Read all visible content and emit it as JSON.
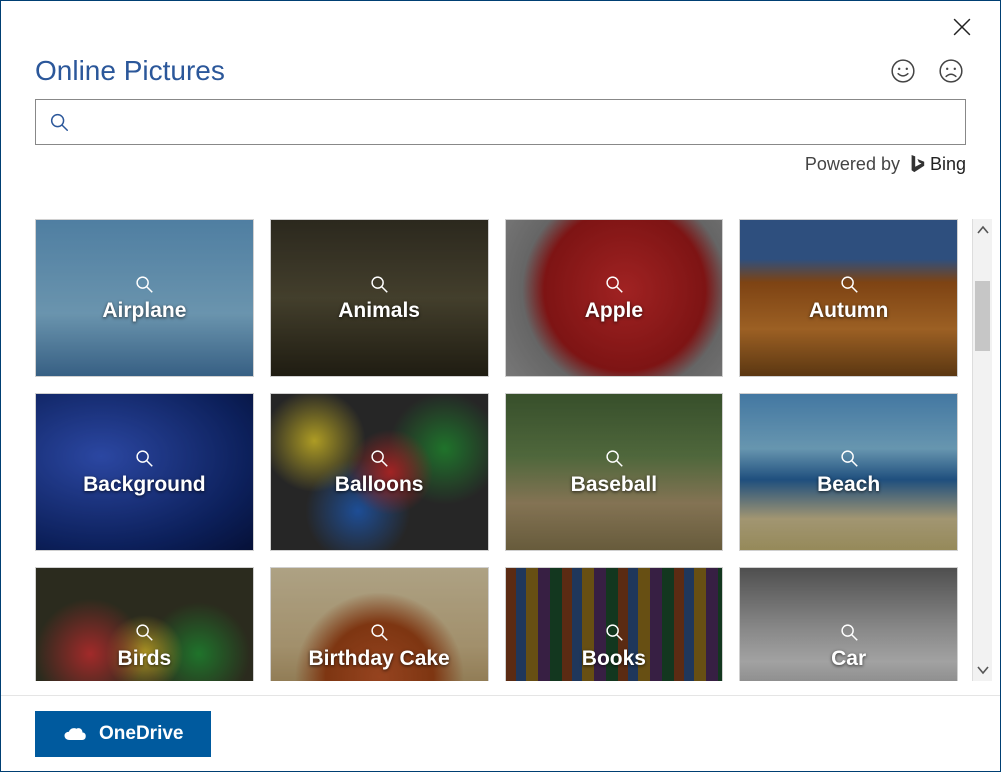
{
  "title": "Online Pictures",
  "powered_label": "Powered by",
  "bing_label": "Bing",
  "search": {
    "value": "",
    "placeholder": ""
  },
  "onedrive_label": "OneDrive",
  "categories": [
    {
      "label": "Airplane",
      "bg": "bg-airplane"
    },
    {
      "label": "Animals",
      "bg": "bg-animals"
    },
    {
      "label": "Apple",
      "bg": "bg-apple"
    },
    {
      "label": "Autumn",
      "bg": "bg-autumn"
    },
    {
      "label": "Background",
      "bg": "bg-background"
    },
    {
      "label": "Balloons",
      "bg": "bg-balloons"
    },
    {
      "label": "Baseball",
      "bg": "bg-baseball"
    },
    {
      "label": "Beach",
      "bg": "bg-beach"
    },
    {
      "label": "Birds",
      "bg": "bg-birds"
    },
    {
      "label": "Birthday Cake",
      "bg": "bg-cake"
    },
    {
      "label": "Books",
      "bg": "bg-books"
    },
    {
      "label": "Car",
      "bg": "bg-car"
    }
  ]
}
